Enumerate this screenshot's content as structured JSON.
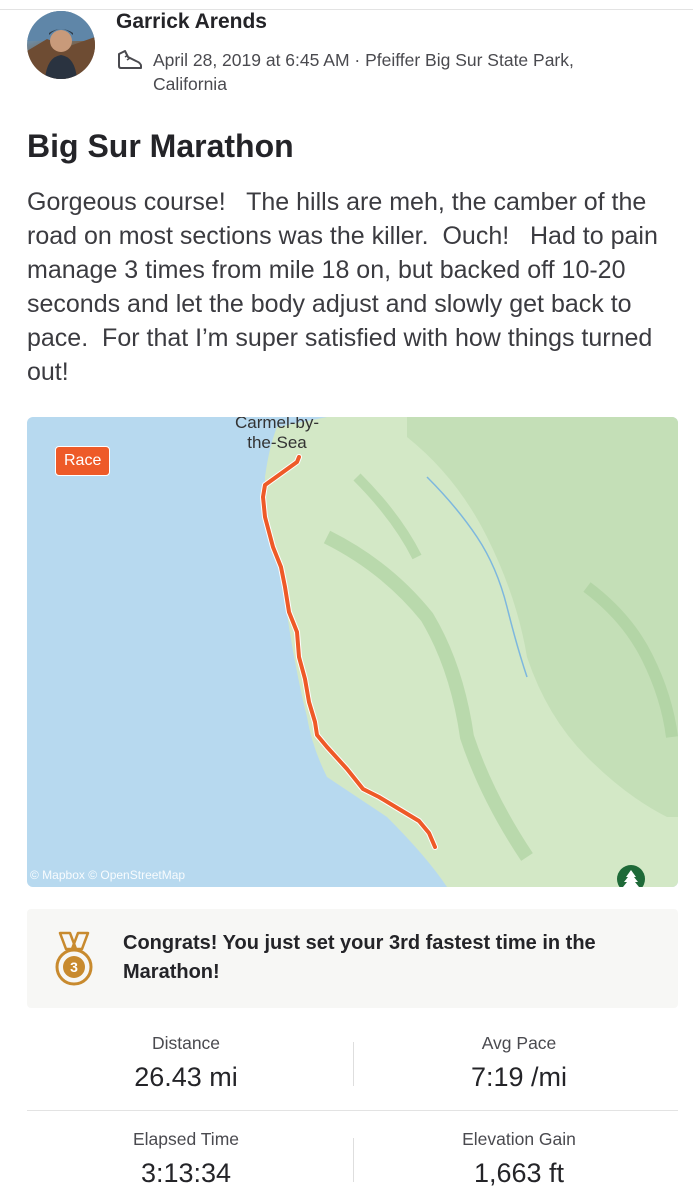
{
  "athlete": {
    "name": "Garrick Arends",
    "meta_line": "April 28, 2019 at 6:45 AM · Pfeiffer Big Sur State Park, California"
  },
  "activity": {
    "title": "Big Sur Marathon",
    "description": "Gorgeous course!   The hills are meh, the camber of the road on most sections was the killer.  Ouch!   Had to pain manage 3 times from mile 18 on, but backed off 10-20 seconds and let the body adjust and slowly get back to pace.  For that I’m super satisfied with how things turned out!"
  },
  "map": {
    "race_badge": "Race",
    "place_label_line1": "Carmel-by-",
    "place_label_line2": "the-Sea",
    "attribution": "© Mapbox © OpenStreetMap",
    "route_color": "#ee5a28",
    "water_color": "#b7d9ef",
    "land_color": "#cfe6c4",
    "park_icon": "tree-icon"
  },
  "achievement": {
    "icon": "medal-3-icon",
    "text": "Congrats! You just set your 3rd fastest time in the Marathon!",
    "medal_number": "3"
  },
  "stats": {
    "distance": {
      "label": "Distance",
      "value": "26.43 mi"
    },
    "avg_pace": {
      "label": "Avg Pace",
      "value": "7:19 /mi"
    },
    "elapsed_time": {
      "label": "Elapsed Time",
      "value": "3:13:34"
    },
    "elevation_gain": {
      "label": "Elevation Gain",
      "value": "1,663 ft"
    }
  },
  "colors": {
    "brand": "#fc5200",
    "medal": "#c88a2e"
  }
}
